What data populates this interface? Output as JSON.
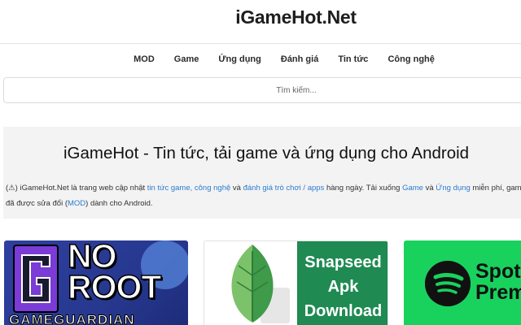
{
  "site": {
    "logo": "iGameHot.Net"
  },
  "nav": {
    "items": [
      {
        "label": "MOD"
      },
      {
        "label": "Game"
      },
      {
        "label": "Ứng dụng"
      },
      {
        "label": "Đánh giá"
      },
      {
        "label": "Tin tức"
      },
      {
        "label": "Công nghệ"
      }
    ]
  },
  "search": {
    "placeholder": "Tìm kiếm..."
  },
  "intro": {
    "title": "iGameHot - Tin tức, tải game và ứng dụng cho Android",
    "icon": "(⚠)",
    "text_1": " iGameHot.Net là trang web cập nhật ",
    "link_1": "tin tức game, công nghệ",
    "text_2": " và ",
    "link_2": "đánh giá trò chơi / apps",
    "text_3": " hàng ngày. Tải xuống ",
    "link_3": "Game",
    "text_4": " và ",
    "link_4": "Ứng dụng",
    "text_5": " miễn phí, game đã được sửa đổi (",
    "link_5": "MOD",
    "text_6": ") dành cho Android."
  },
  "cards": [
    {
      "title_line1": "NO",
      "title_line2": "ROOT",
      "bottom": "GAMEGUARDIAN",
      "color": "#2f3fa0"
    },
    {
      "line1": "Snapseed",
      "line2": "Apk",
      "line3": "Download",
      "color": "#1f8a52"
    },
    {
      "line1": "Spot",
      "line2": "Prem",
      "color": "#19d25e"
    }
  ]
}
